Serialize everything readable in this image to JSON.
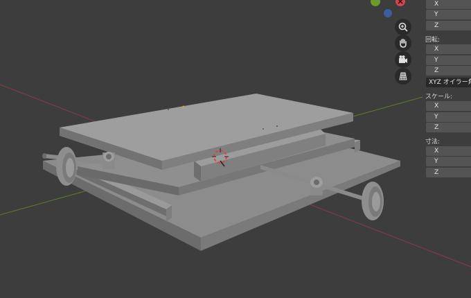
{
  "viewport": {
    "nav_buttons": [
      {
        "name": "zoom-icon"
      },
      {
        "name": "hand-pan-icon"
      },
      {
        "name": "camera-view-icon"
      },
      {
        "name": "ortho-grid-icon"
      }
    ],
    "colors": {
      "background": "#3d3d3d",
      "x_axis": "#8a3b47",
      "y_axis": "#5d7a2e"
    }
  },
  "npanel": {
    "location": {
      "axes": [
        "X",
        "Y",
        "Z"
      ]
    },
    "rotation": {
      "label": "回転:",
      "axes": [
        "X",
        "Y",
        "Z"
      ],
      "mode": "XYZ オイラー角"
    },
    "scale": {
      "label": "スケール:",
      "axes": [
        "X",
        "Y",
        "Z"
      ]
    },
    "dimensions": {
      "label": "寸法:",
      "axes": [
        "X",
        "Y",
        "Z"
      ]
    }
  }
}
